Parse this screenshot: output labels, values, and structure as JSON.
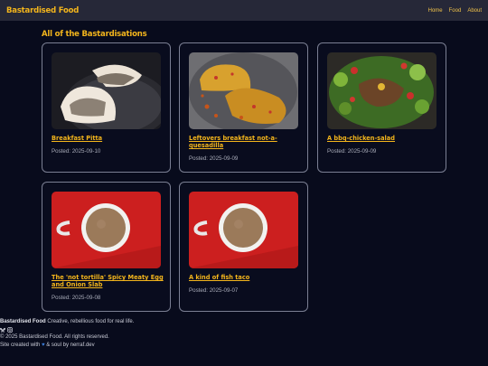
{
  "nav": {
    "brand": "Bastardised Food",
    "links": [
      "Home",
      "Food",
      "About"
    ]
  },
  "main": {
    "heading": "All of the Bastardisations",
    "posts": [
      {
        "title": "Breakfast Pitta",
        "date": "Posted: 2025-09-10",
        "image": "pitta-photo"
      },
      {
        "title": "Leftovers breakfast not-a-quesadilla",
        "date": "Posted: 2025-09-09",
        "image": "omelette-photo"
      },
      {
        "title": "A bbq-chicken-salad",
        "date": "Posted: 2025-09-09",
        "image": "salad-photo"
      },
      {
        "title": "The 'not tortilla' Spicy Meaty Egg and Onion Slab",
        "date": "Posted: 2025-09-08",
        "image": "coffee-photo"
      },
      {
        "title": "A kind of fish taco",
        "date": "Posted: 2025-09-07",
        "image": "coffee-photo"
      }
    ]
  },
  "footer": {
    "brand": "Bastardised Food",
    "tagline": "Creative, rebellious food for real life.",
    "social_icons": [
      "butterfly-icon",
      "instagram-icon"
    ],
    "copyright": "© 2025 Bastardised Food. All rights reserved.",
    "credit_prefix": "Site created with",
    "credit_suffix": "& soul by nerraf.dev",
    "heart_color": "#3b7dd8"
  },
  "colors": {
    "accent": "#f3b51c",
    "background": "#080b1c",
    "navbar": "#262838"
  }
}
